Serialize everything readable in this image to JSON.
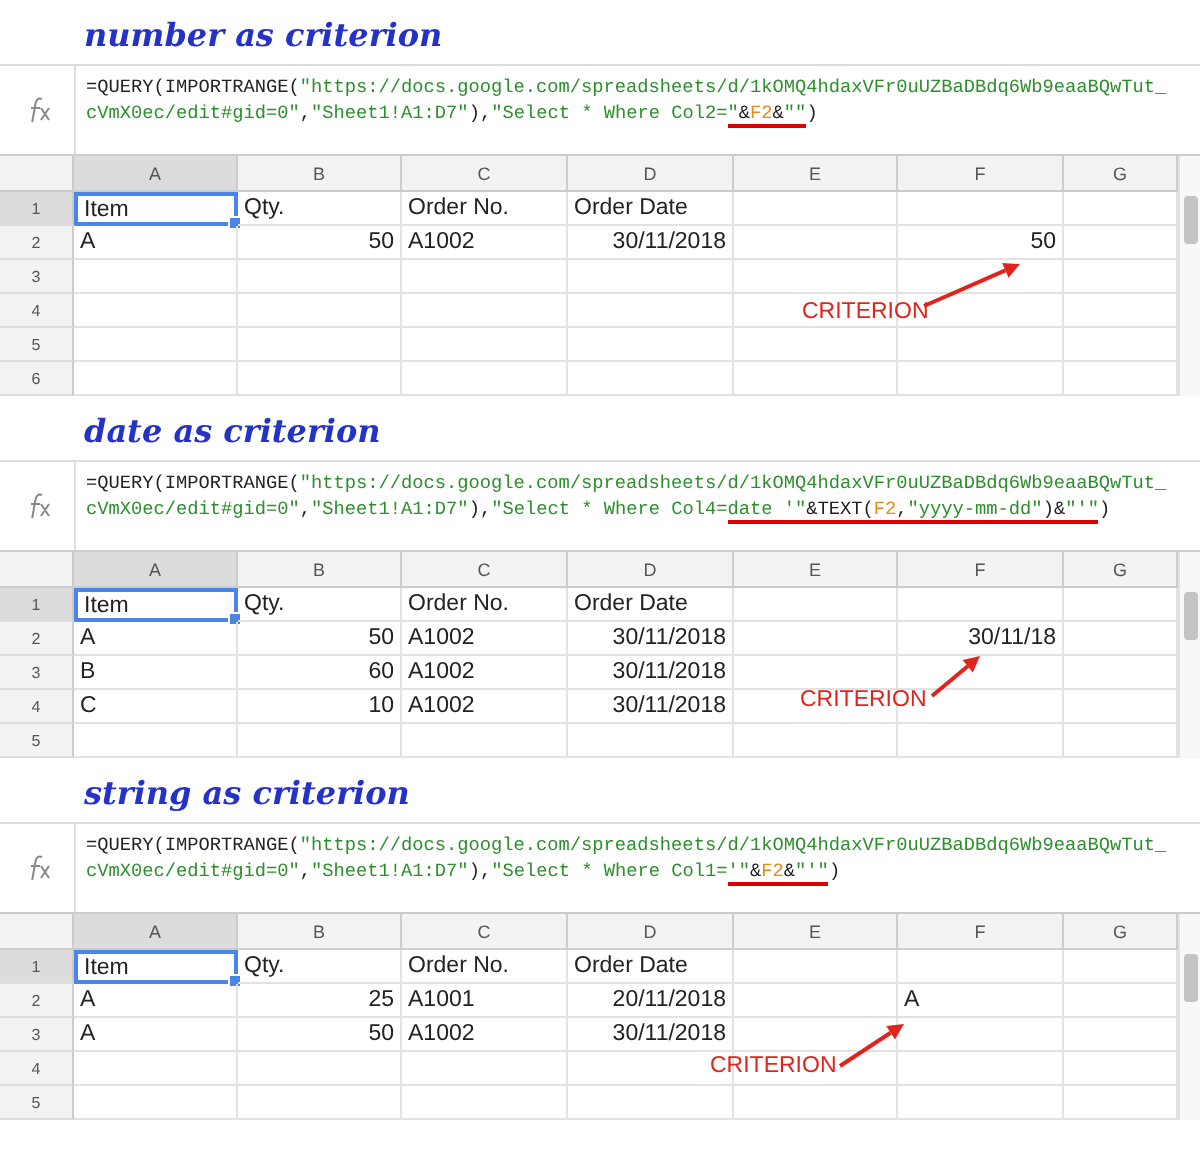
{
  "panels": [
    {
      "heading": "number as criterion",
      "formula": {
        "lines": [
          [
            {
              "text": "=QUERY(IMPORTRANGE(",
              "kind": "plain",
              "underlined": false
            },
            {
              "text": "\"https://docs.google.com/spreadsheets/d/1kOMQ4hdaxVFr0uUZBaDBdq6Wb9eaaBQwTut_",
              "kind": "string",
              "underlined": false
            }
          ],
          [
            {
              "text": "cVmX0ec/edit#gid=0\"",
              "kind": "string",
              "underlined": false
            },
            {
              "text": ",",
              "kind": "plain",
              "underlined": false
            },
            {
              "text": "\"Sheet1!A1:D7\"",
              "kind": "string",
              "underlined": false
            },
            {
              "text": "),",
              "kind": "plain",
              "underlined": false
            },
            {
              "text": "\"Select * Where Col2=",
              "kind": "string",
              "underlined": false
            },
            {
              "text": "\"",
              "kind": "string",
              "underlined": true
            },
            {
              "text": "&",
              "kind": "plain",
              "underlined": true
            },
            {
              "text": "F2",
              "kind": "ref",
              "underlined": true
            },
            {
              "text": "&",
              "kind": "plain",
              "underlined": true
            },
            {
              "text": "\"\"",
              "kind": "string",
              "underlined": true
            },
            {
              "text": ")",
              "kind": "plain",
              "underlined": false
            }
          ]
        ]
      },
      "columns": [
        {
          "label": "A",
          "selected": true
        },
        {
          "label": "B",
          "selected": false
        },
        {
          "label": "C",
          "selected": false
        },
        {
          "label": "D",
          "selected": false
        },
        {
          "label": "E",
          "selected": false
        },
        {
          "label": "F",
          "selected": false
        },
        {
          "label": "G",
          "selected": false
        }
      ],
      "rows": [
        {
          "number": "1",
          "selected": true,
          "cells": [
            {
              "text": "Item",
              "kind": "text"
            },
            {
              "text": "Qty.",
              "kind": "text"
            },
            {
              "text": "Order No.",
              "kind": "text"
            },
            {
              "text": "Order Date",
              "kind": "text"
            },
            {
              "text": "",
              "kind": "empty"
            },
            {
              "text": "",
              "kind": "empty"
            },
            {
              "text": "",
              "kind": "empty"
            }
          ]
        },
        {
          "number": "2",
          "selected": false,
          "cells": [
            {
              "text": "A",
              "kind": "text"
            },
            {
              "text": "50",
              "kind": "number"
            },
            {
              "text": "A1002",
              "kind": "text"
            },
            {
              "text": "30/11/2018",
              "kind": "number"
            },
            {
              "text": "",
              "kind": "empty"
            },
            {
              "text": "50",
              "kind": "number"
            },
            {
              "text": "",
              "kind": "empty"
            }
          ]
        },
        {
          "number": "3",
          "selected": false,
          "cells": []
        },
        {
          "number": "4",
          "selected": false,
          "cells": []
        },
        {
          "number": "5",
          "selected": false,
          "cells": []
        },
        {
          "number": "6",
          "selected": false,
          "cells": []
        }
      ],
      "annotation": "CRITERION"
    },
    {
      "heading": "date as criterion",
      "formula": {
        "lines": [
          [
            {
              "text": "=QUERY(IMPORTRANGE(",
              "kind": "plain",
              "underlined": false
            },
            {
              "text": "\"https://docs.google.com/spreadsheets/d/1kOMQ4hdaxVFr0uUZBaDBdq6Wb9eaaBQwTut_",
              "kind": "string",
              "underlined": false
            }
          ],
          [
            {
              "text": "cVmX0ec/edit#gid=0\"",
              "kind": "string",
              "underlined": false
            },
            {
              "text": ",",
              "kind": "plain",
              "underlined": false
            },
            {
              "text": "\"Sheet1!A1:D7\"",
              "kind": "string",
              "underlined": false
            },
            {
              "text": "),",
              "kind": "plain",
              "underlined": false
            },
            {
              "text": "\"Select * Where Col4=",
              "kind": "string",
              "underlined": false
            },
            {
              "text": "date '\"",
              "kind": "string",
              "underlined": true
            },
            {
              "text": "&TEXT(",
              "kind": "plain",
              "underlined": true
            },
            {
              "text": "F2",
              "kind": "ref",
              "underlined": true
            },
            {
              "text": ",",
              "kind": "plain",
              "underlined": true
            },
            {
              "text": "\"yyyy-mm-dd\"",
              "kind": "string",
              "underlined": true
            },
            {
              "text": ")&",
              "kind": "plain",
              "underlined": true
            },
            {
              "text": "\"'\"",
              "kind": "string",
              "underlined": true
            },
            {
              "text": ")",
              "kind": "plain",
              "underlined": false
            }
          ]
        ]
      },
      "columns": [
        {
          "label": "A",
          "selected": true
        },
        {
          "label": "B",
          "selected": false
        },
        {
          "label": "C",
          "selected": false
        },
        {
          "label": "D",
          "selected": false
        },
        {
          "label": "E",
          "selected": false
        },
        {
          "label": "F",
          "selected": false
        },
        {
          "label": "G",
          "selected": false
        }
      ],
      "rows": [
        {
          "number": "1",
          "selected": true,
          "cells": [
            {
              "text": "Item",
              "kind": "text"
            },
            {
              "text": "Qty.",
              "kind": "text"
            },
            {
              "text": "Order No.",
              "kind": "text"
            },
            {
              "text": "Order Date",
              "kind": "text"
            },
            {
              "text": "",
              "kind": "empty"
            },
            {
              "text": "",
              "kind": "empty"
            },
            {
              "text": "",
              "kind": "empty"
            }
          ]
        },
        {
          "number": "2",
          "selected": false,
          "cells": [
            {
              "text": "A",
              "kind": "text"
            },
            {
              "text": "50",
              "kind": "number"
            },
            {
              "text": "A1002",
              "kind": "text"
            },
            {
              "text": "30/11/2018",
              "kind": "number"
            },
            {
              "text": "",
              "kind": "empty"
            },
            {
              "text": "30/11/18",
              "kind": "number"
            },
            {
              "text": "",
              "kind": "empty"
            }
          ]
        },
        {
          "number": "3",
          "selected": false,
          "cells": [
            {
              "text": "B",
              "kind": "text"
            },
            {
              "text": "60",
              "kind": "number"
            },
            {
              "text": "A1002",
              "kind": "text"
            },
            {
              "text": "30/11/2018",
              "kind": "number"
            },
            {
              "text": "",
              "kind": "empty"
            },
            {
              "text": "",
              "kind": "empty"
            },
            {
              "text": "",
              "kind": "empty"
            }
          ]
        },
        {
          "number": "4",
          "selected": false,
          "cells": [
            {
              "text": "C",
              "kind": "text"
            },
            {
              "text": "10",
              "kind": "number"
            },
            {
              "text": "A1002",
              "kind": "text"
            },
            {
              "text": "30/11/2018",
              "kind": "number"
            },
            {
              "text": "",
              "kind": "empty"
            },
            {
              "text": "",
              "kind": "empty"
            },
            {
              "text": "",
              "kind": "empty"
            }
          ]
        },
        {
          "number": "5",
          "selected": false,
          "cells": []
        }
      ],
      "annotation": "CRITERION"
    },
    {
      "heading": "string as criterion",
      "formula": {
        "lines": [
          [
            {
              "text": "=QUERY(IMPORTRANGE(",
              "kind": "plain",
              "underlined": false
            },
            {
              "text": "\"https://docs.google.com/spreadsheets/d/1kOMQ4hdaxVFr0uUZBaDBdq6Wb9eaaBQwTut_",
              "kind": "string",
              "underlined": false
            }
          ],
          [
            {
              "text": "cVmX0ec/edit#gid=0\"",
              "kind": "string",
              "underlined": false
            },
            {
              "text": ",",
              "kind": "plain",
              "underlined": false
            },
            {
              "text": "\"Sheet1!A1:D7\"",
              "kind": "string",
              "underlined": false
            },
            {
              "text": "),",
              "kind": "plain",
              "underlined": false
            },
            {
              "text": "\"Select * Where Col1=",
              "kind": "string",
              "underlined": false
            },
            {
              "text": "'\"",
              "kind": "string",
              "underlined": true
            },
            {
              "text": "&",
              "kind": "plain",
              "underlined": true
            },
            {
              "text": "F2",
              "kind": "ref",
              "underlined": true
            },
            {
              "text": "&",
              "kind": "plain",
              "underlined": true
            },
            {
              "text": "\"'\"",
              "kind": "string",
              "underlined": true
            },
            {
              "text": ")",
              "kind": "plain",
              "underlined": false
            }
          ]
        ]
      },
      "columns": [
        {
          "label": "A",
          "selected": true
        },
        {
          "label": "B",
          "selected": false
        },
        {
          "label": "C",
          "selected": false
        },
        {
          "label": "D",
          "selected": false
        },
        {
          "label": "E",
          "selected": false
        },
        {
          "label": "F",
          "selected": false
        },
        {
          "label": "G",
          "selected": false
        }
      ],
      "rows": [
        {
          "number": "1",
          "selected": true,
          "cells": [
            {
              "text": "Item",
              "kind": "text"
            },
            {
              "text": "Qty.",
              "kind": "text"
            },
            {
              "text": "Order No.",
              "kind": "text"
            },
            {
              "text": "Order Date",
              "kind": "text"
            },
            {
              "text": "",
              "kind": "empty"
            },
            {
              "text": "",
              "kind": "empty"
            },
            {
              "text": "",
              "kind": "empty"
            }
          ]
        },
        {
          "number": "2",
          "selected": false,
          "cells": [
            {
              "text": "A",
              "kind": "text"
            },
            {
              "text": "25",
              "kind": "number"
            },
            {
              "text": "A1001",
              "kind": "text"
            },
            {
              "text": "20/11/2018",
              "kind": "number"
            },
            {
              "text": "",
              "kind": "empty"
            },
            {
              "text": "A",
              "kind": "text"
            },
            {
              "text": "",
              "kind": "empty"
            }
          ]
        },
        {
          "number": "3",
          "selected": false,
          "cells": [
            {
              "text": "A",
              "kind": "text"
            },
            {
              "text": "50",
              "kind": "number"
            },
            {
              "text": "A1002",
              "kind": "text"
            },
            {
              "text": "30/11/2018",
              "kind": "number"
            },
            {
              "text": "",
              "kind": "empty"
            },
            {
              "text": "",
              "kind": "empty"
            },
            {
              "text": "",
              "kind": "empty"
            }
          ]
        },
        {
          "number": "4",
          "selected": false,
          "cells": []
        },
        {
          "number": "5",
          "selected": false,
          "cells": []
        }
      ],
      "annotation": "CRITERION"
    }
  ]
}
